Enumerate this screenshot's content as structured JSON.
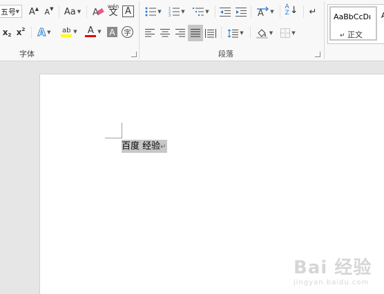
{
  "font_group": {
    "font_size": "五号",
    "grow_font": "A",
    "shrink_font": "A",
    "change_case": "Aa",
    "clear_format": "A",
    "phonetic_guide": "文",
    "phonetic_guide_ruby": "wén",
    "char_border": "A",
    "subscript": "x",
    "subscript_mark": "2",
    "superscript": "x",
    "superscript_mark": "2",
    "text_effects": "A",
    "highlight": "ab",
    "font_color": "A",
    "char_shading": "A",
    "enclose_char": "字",
    "label": "字体"
  },
  "paragraph_group": {
    "sort": "A",
    "sort_to": "Z",
    "label": "段落"
  },
  "styles_group": {
    "preview_text": "AaBbCcDı",
    "style_name": "正文",
    "next_preview": "A"
  },
  "document": {
    "selected_text": "百度 经验",
    "pilcrow": "↵"
  },
  "watermark": {
    "text_big": "Bai  经验",
    "text_small": "jingyan.baidu.com"
  },
  "colors": {
    "highlight_yellow": "#ffff00",
    "font_red": "#e00000"
  }
}
